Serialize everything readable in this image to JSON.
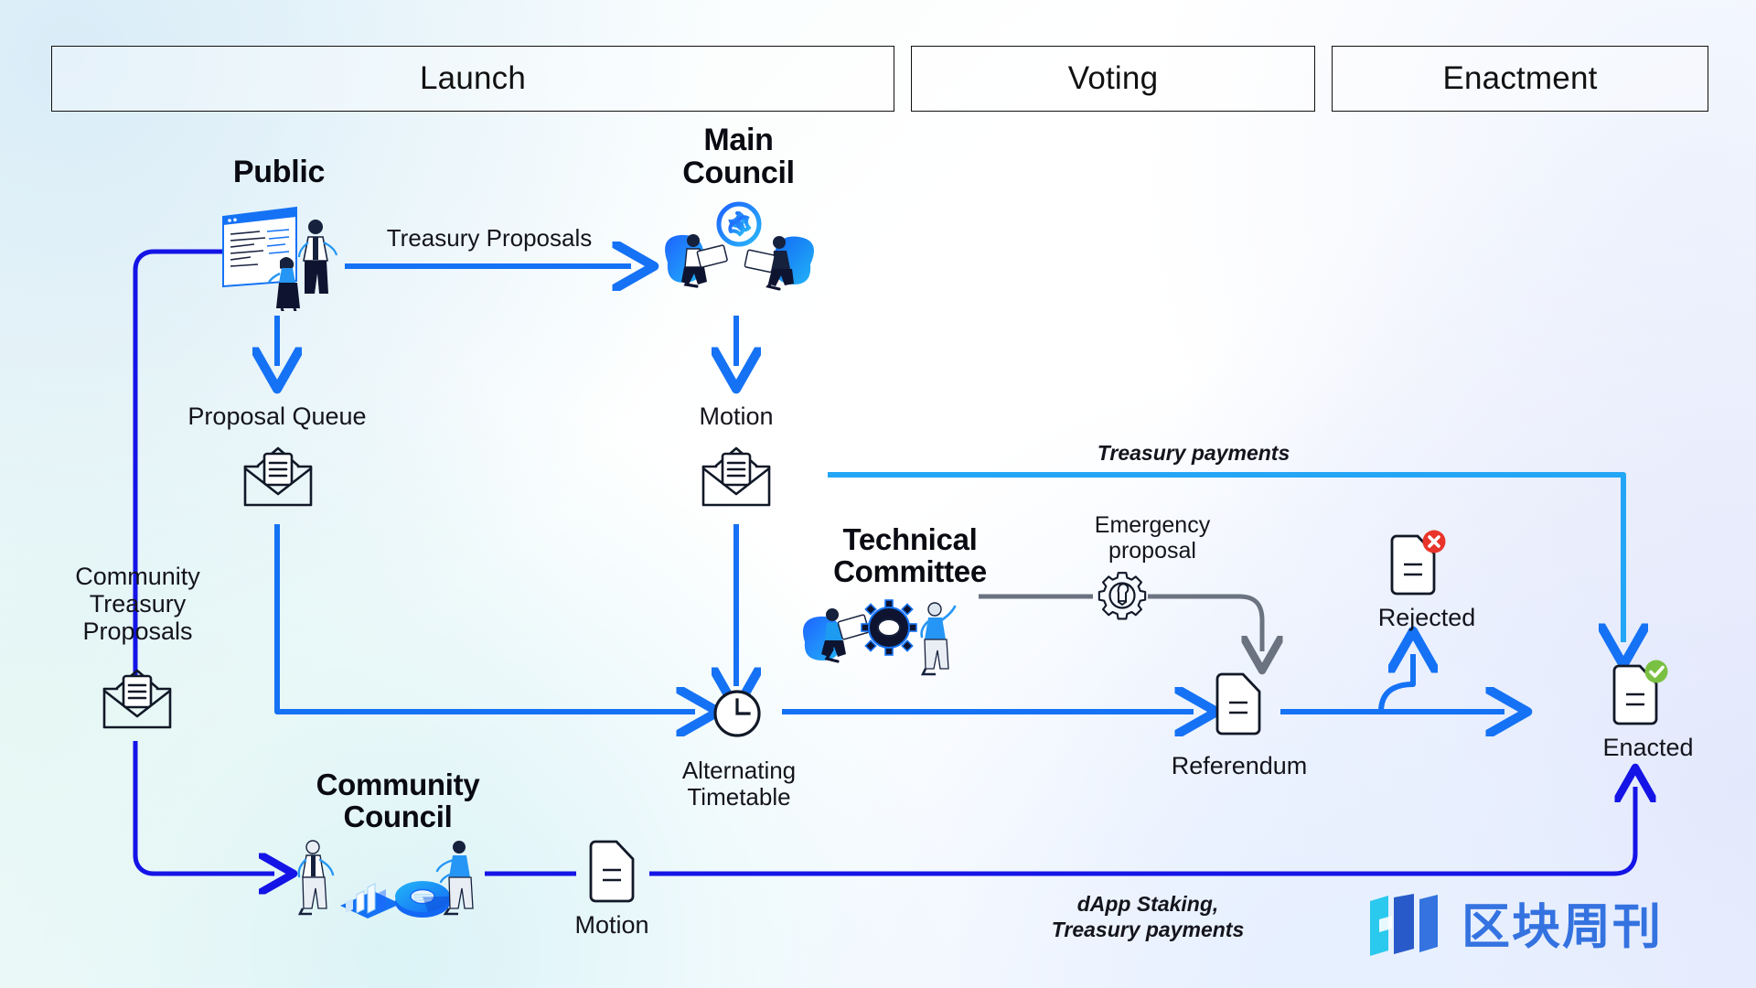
{
  "phases": [
    {
      "id": "launch",
      "label": "Launch"
    },
    {
      "id": "voting",
      "label": "Voting"
    },
    {
      "id": "enactment",
      "label": "Enactment"
    }
  ],
  "nodes": {
    "public": {
      "title": "Public",
      "icon": "public-presentation-icon"
    },
    "main_council": {
      "title": "Main\nCouncil",
      "title_line1": "Main",
      "title_line2": "Council",
      "icon": "main-council-icon"
    },
    "proposal_queue": {
      "label": "Proposal Queue",
      "icon": "envelope-icon"
    },
    "motion_council": {
      "label": "Motion",
      "icon": "envelope-icon"
    },
    "community_treasury_proposals": {
      "label_line1": "Community",
      "label_line2": "Treasury",
      "label_line3": "Proposals",
      "icon": "envelope-icon"
    },
    "technical_committee": {
      "title_line1": "Technical",
      "title_line2": "Committee",
      "icon": "technical-committee-icon"
    },
    "emergency_proposal": {
      "label_line1": "Emergency",
      "label_line2": "proposal",
      "icon": "gear-wrench-icon"
    },
    "alternating_timetable": {
      "label_line1": "Alternating",
      "label_line2": "Timetable",
      "icon": "clock-icon"
    },
    "referendum": {
      "label": "Referendum",
      "icon": "document-icon"
    },
    "rejected": {
      "label": "Rejected",
      "icon": "document-rejected-icon",
      "badge": "x-badge"
    },
    "enacted": {
      "label": "Enacted",
      "icon": "document-enacted-icon",
      "badge": "check-badge"
    },
    "community_council": {
      "title_line1": "Community",
      "title_line2": "Council",
      "icon": "community-council-icon"
    },
    "motion_community": {
      "label": "Motion",
      "icon": "document-icon"
    }
  },
  "edges": {
    "treasury_proposals": "Treasury Proposals",
    "treasury_payments": "Treasury payments",
    "dapp_staking": {
      "line1": "dApp Staking,",
      "line2": "Treasury payments"
    }
  },
  "watermark": {
    "text": "区块周刊",
    "mark": "blockweekly-logo"
  },
  "colors": {
    "accent_blue": "#1572f5",
    "light_blue": "#23a6f5",
    "deep_blue": "#1414e6",
    "gray_arrow": "#6b7280",
    "ink": "#14141c",
    "reject_red": "#e8342a",
    "enact_green": "#7ac143"
  }
}
